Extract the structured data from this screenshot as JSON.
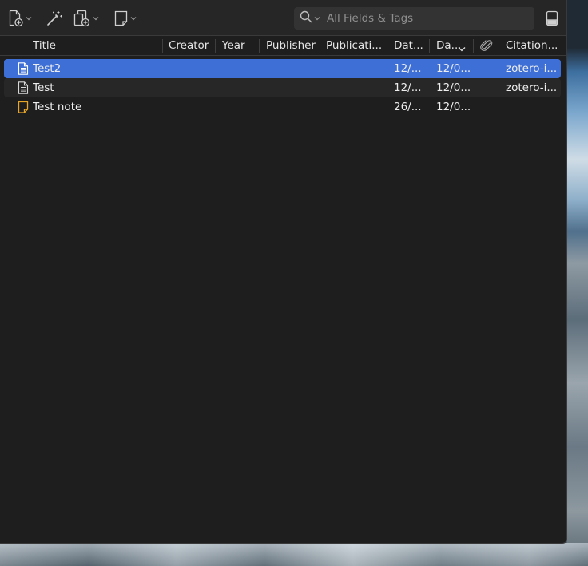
{
  "toolbar": {
    "new_item_icon": "new-item-icon",
    "add_by_identifier_icon": "magic-wand-icon",
    "add_attachment_icon": "add-attachment-icon",
    "new_note_icon": "new-note-icon",
    "search_placeholder": "All Fields & Tags",
    "search_value": "",
    "pane_toggle_icon": "item-pane-toggle-icon"
  },
  "columns": {
    "title": "Title",
    "creator": "Creator",
    "year": "Year",
    "publisher": "Publisher",
    "publication": "Publicati...",
    "date_added": "Dat...",
    "date_modified": "Da...",
    "attachments_icon": "paperclip-icon",
    "citation": "Citation..."
  },
  "items": [
    {
      "title": "Test2",
      "date_added": "12/...",
      "date_modified": "12/0...",
      "citation": "zotero-i...",
      "type": "document",
      "selected": true
    },
    {
      "title": "Test",
      "date_added": "12/...",
      "date_modified": "12/0...",
      "citation": "zotero-i...",
      "type": "document",
      "selected": false
    },
    {
      "title": "Test note",
      "date_added": "26/...",
      "date_modified": "12/0...",
      "citation": "",
      "type": "note",
      "selected": false
    }
  ],
  "colors": {
    "window_bg": "#1e1e1e",
    "toolbar_bg": "#262626",
    "selection": "#3d6fd6",
    "note_icon": "#e8a628"
  }
}
